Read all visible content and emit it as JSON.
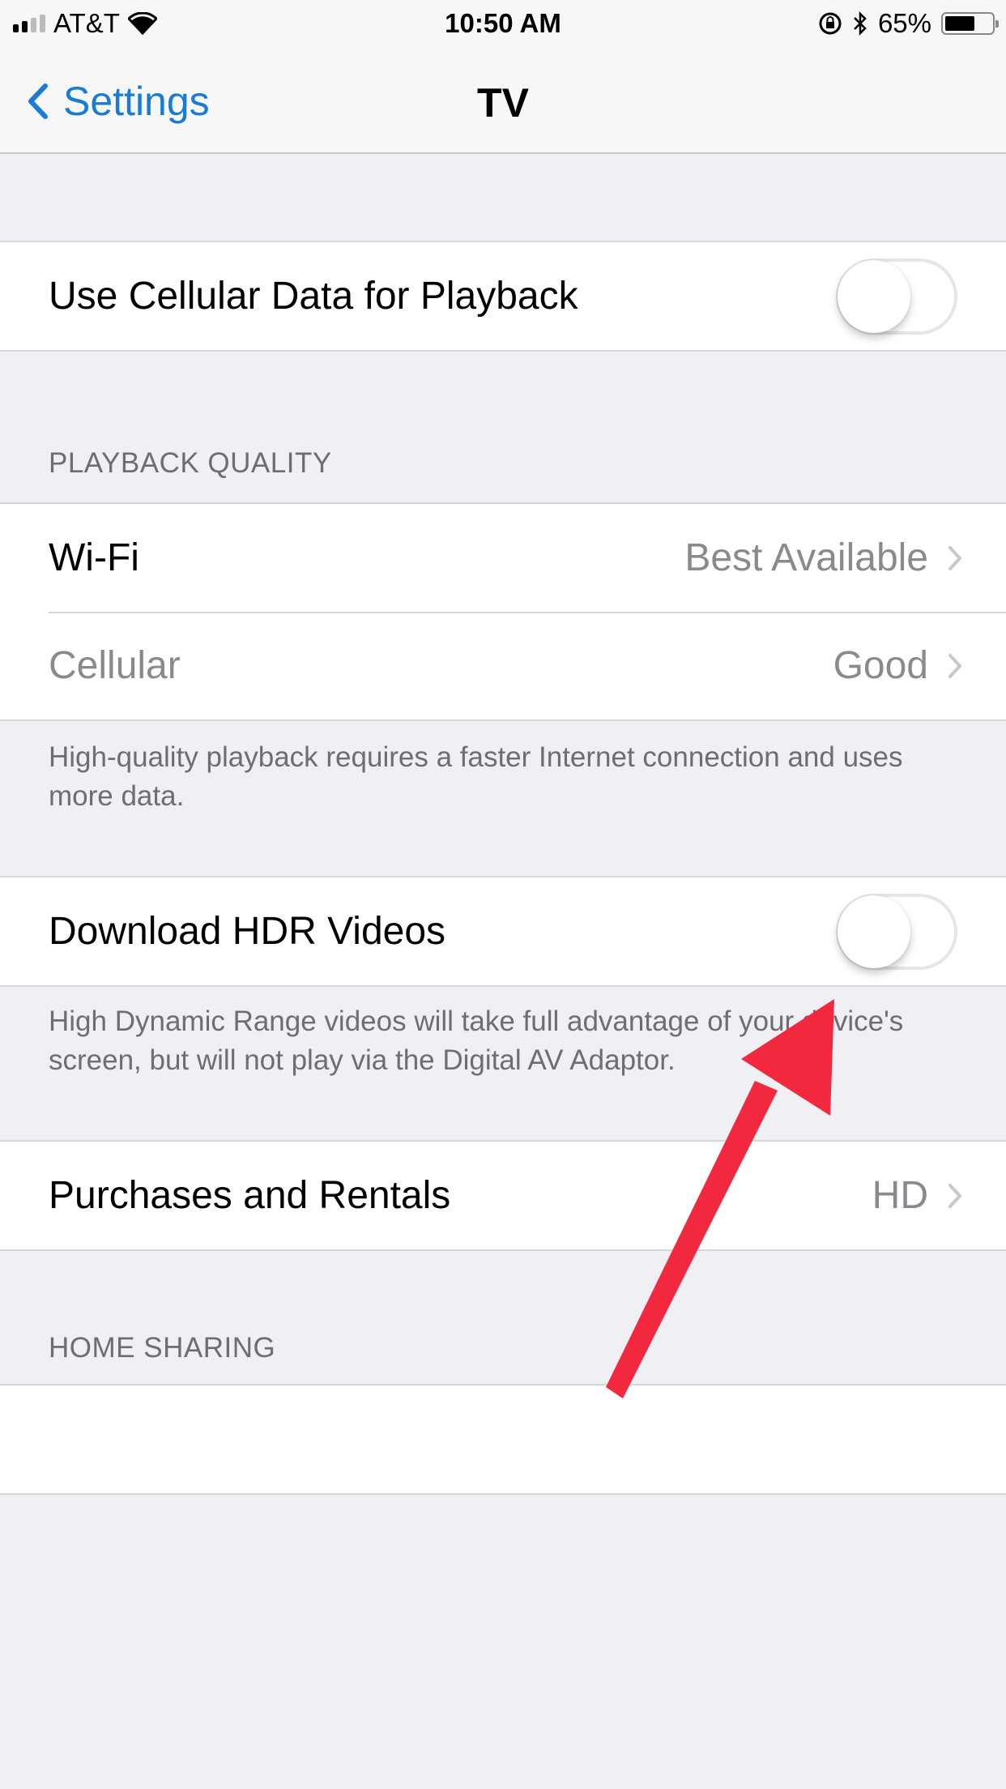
{
  "status_bar": {
    "carrier": "AT&T",
    "time": "10:50 AM",
    "battery_percent_label": "65%",
    "battery_level": 0.65,
    "signal_bars_filled": 2,
    "signal_bars_total": 4,
    "icons": [
      "signal-icon",
      "wifi-icon",
      "rotation-lock-icon",
      "bluetooth-icon",
      "battery-icon"
    ]
  },
  "nav": {
    "back_label": "Settings",
    "title": "TV"
  },
  "sections": {
    "cellular_playback": {
      "label": "Use Cellular Data for Playback",
      "enabled": false
    },
    "playback_quality": {
      "header": "PLAYBACK QUALITY",
      "rows": [
        {
          "label": "Wi-Fi",
          "value": "Best Available"
        },
        {
          "label": "Cellular",
          "value": "Good",
          "dimmed": true
        }
      ],
      "footer": "High-quality playback requires a faster Internet connection and uses more data."
    },
    "hdr": {
      "label": "Download HDR Videos",
      "enabled": false,
      "footer": "High Dynamic Range videos will take full advantage of your device's screen, but will not play via the Digital AV Adaptor."
    },
    "purchases": {
      "label": "Purchases and Rentals",
      "value": "HD"
    },
    "home_sharing": {
      "header": "HOME SHARING"
    }
  },
  "annotation": {
    "type": "arrow",
    "color": "#f2283e",
    "points_to": "Download HDR Videos toggle"
  }
}
